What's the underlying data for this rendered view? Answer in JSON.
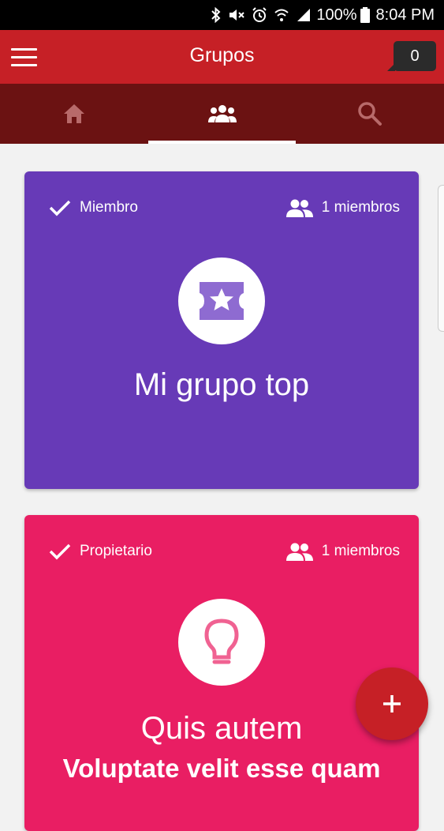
{
  "status_bar": {
    "battery": "100%",
    "time": "8:04 PM"
  },
  "app_bar": {
    "title": "Grupos",
    "notification_count": "0"
  },
  "tabs": [
    {
      "name": "home",
      "icon": "home-icon",
      "active": false
    },
    {
      "name": "groups",
      "icon": "groups-icon",
      "active": true
    },
    {
      "name": "search",
      "icon": "search-icon",
      "active": false
    }
  ],
  "cards": [
    {
      "role": "Miembro",
      "members": "1 miembros",
      "icon": "ticket-star-icon",
      "title": "Mi grupo top",
      "color": "#673ab7"
    },
    {
      "role": "Propietario",
      "members": "1 miembros",
      "icon": "lightbulb-icon",
      "title": "Quis autem",
      "subtitle": "Voluptate velit esse quam",
      "color": "#e91e63"
    }
  ],
  "colors": {
    "primary": "#c62026",
    "tab_bar": "#6b1212",
    "background": "#f2f2f2"
  }
}
